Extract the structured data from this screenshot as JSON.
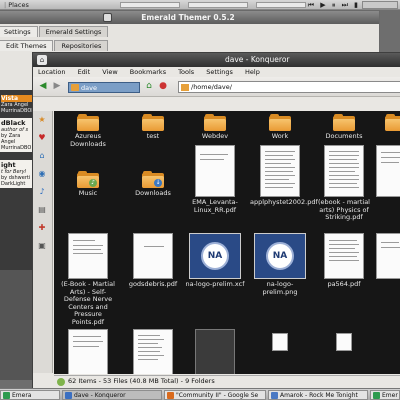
{
  "top_panel": {
    "places_label": "Places"
  },
  "emerald": {
    "title": "Emerald Themer 0.5.2",
    "tabs_row1": [
      "Settings",
      "Emerald Settings"
    ],
    "tabs_row2": [
      "Edit Themes",
      "Repositories"
    ]
  },
  "left_panel": {
    "card1_title": "Vista",
    "card1_lines": [
      "Zara Angel",
      "MurrinaDBOE"
    ],
    "card2_title": "dBlack",
    "card2_lines": [
      "author of s"
    ],
    "card2_sub": [
      "by Zara Angel",
      "MurrinaDBO"
    ],
    "card3_title": "ight",
    "card3_lines": [
      "t for Beryl",
      "by dshwerti",
      "DarkLight"
    ]
  },
  "konqueror": {
    "window_title": "dave - Konqueror",
    "menu": [
      "Location",
      "Edit",
      "View",
      "Bookmarks",
      "Tools",
      "Settings",
      "Help"
    ],
    "tab_label": "dave",
    "url": "/home/dave/",
    "files": [
      {
        "name": "Azureus Downloads",
        "kind": "folder"
      },
      {
        "name": "test",
        "kind": "folder"
      },
      {
        "name": "Webdev",
        "kind": "folder"
      },
      {
        "name": "Work",
        "kind": "folder"
      },
      {
        "name": "Documents",
        "kind": "folder"
      },
      {
        "name": "Music",
        "kind": "folder"
      },
      {
        "name": "Downloads",
        "kind": "folder"
      },
      {
        "name": "EMA_Levanta-Linux_RR.pdf",
        "kind": "pdf"
      },
      {
        "name": "applphystet2002.pdf",
        "kind": "pdf"
      },
      {
        "name": "(ebook - martial arts) Physics of Striking.pdf",
        "kind": "pdf"
      },
      {
        "name": "(E-Book - Martial Arts) - Self-Defense Nerve Centers and Pressure Points.pdf",
        "kind": "pdf"
      },
      {
        "name": "godsdebris.pdf",
        "kind": "pdf"
      },
      {
        "name": "na-logo-prelim.xcf",
        "kind": "image"
      },
      {
        "name": "na-logo-prelim.png",
        "kind": "image"
      },
      {
        "name": "pa564.pdf",
        "kind": "pdf"
      }
    ],
    "status": "62 Items - 53 Files (40.8 MB Total) - 9 Folders"
  },
  "taskbar": {
    "tasks": [
      "Emera",
      "dave - Konqueror",
      "\"Community II\" - Google Se",
      "Amarok - Rock Me Tonight",
      "Emer"
    ]
  }
}
